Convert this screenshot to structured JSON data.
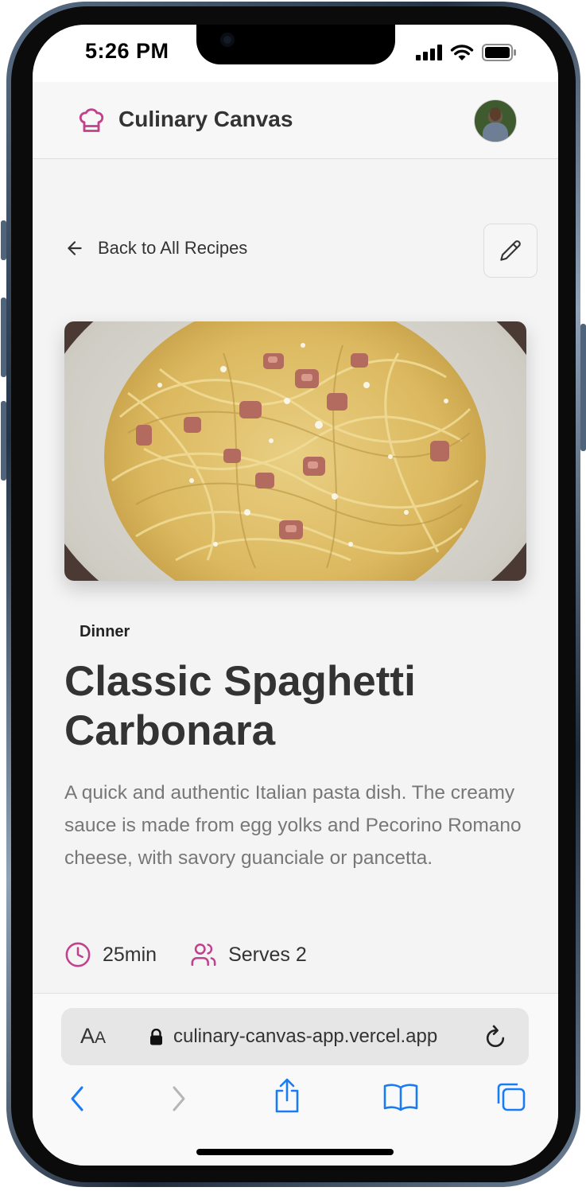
{
  "status_bar": {
    "time": "5:26 PM",
    "icons": [
      "signal-icon",
      "wifi-icon",
      "battery-icon"
    ]
  },
  "header": {
    "logo_icon": "chef-hat-icon",
    "app_name": "Culinary Canvas",
    "avatar": "user-avatar"
  },
  "navigation": {
    "back_label": "Back to All Recipes",
    "back_icon": "arrow-left-icon",
    "edit_icon": "pencil-icon"
  },
  "recipe": {
    "image_alt": "Spaghetti carbonara on a plate",
    "category": "Dinner",
    "title": "Classic Spaghetti Carbonara",
    "description": "A quick and authentic Italian pasta dish. The creamy sauce is made from egg yolks and Pecorino Romano cheese, with savory guanciale or pancetta.",
    "time": "25min",
    "serves": "Serves 2"
  },
  "browser": {
    "text_size_label": "AA",
    "url": "culinary-canvas-app.vercel.app",
    "toolbar_icons": [
      "back-icon",
      "forward-icon",
      "share-icon",
      "bookmarks-icon",
      "tabs-icon"
    ]
  },
  "colors": {
    "accent": "#c2418c",
    "ios_blue": "#1a7cf5",
    "background": "#f4f4f4",
    "title_text": "#333333",
    "description_text": "#777777"
  }
}
